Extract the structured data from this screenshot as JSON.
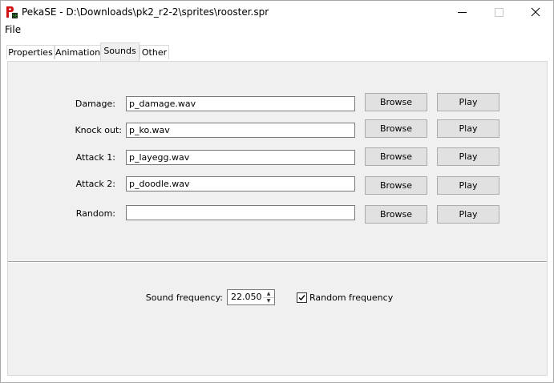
{
  "window": {
    "title": "PekaSE - D:\\Downloads\\pk2_r2-2\\sprites\\rooster.spr",
    "icon_name": "pekase-app-icon"
  },
  "menu": {
    "file": "File"
  },
  "tabs": [
    {
      "label": "Properties",
      "active": false
    },
    {
      "label": "Animation",
      "active": false
    },
    {
      "label": "Sounds",
      "active": true
    },
    {
      "label": "Other",
      "active": false
    }
  ],
  "sounds": {
    "rows": [
      {
        "label": "Damage:",
        "value": "p_damage.wav",
        "browse": "Browse",
        "play": "Play"
      },
      {
        "label": "Knock out:",
        "value": "p_ko.wav",
        "browse": "Browse",
        "play": "Play"
      },
      {
        "label": "Attack 1:",
        "value": "p_layegg.wav",
        "browse": "Browse",
        "play": "Play"
      },
      {
        "label": "Attack 2:",
        "value": "p_doodle.wav",
        "browse": "Browse",
        "play": "Play"
      },
      {
        "label": "Random:",
        "value": "",
        "browse": "Browse",
        "play": "Play"
      }
    ],
    "frequency_label": "Sound frequency:",
    "frequency_value": "22.050",
    "random_frequency_label": "Random frequency",
    "random_frequency_checked": true
  }
}
